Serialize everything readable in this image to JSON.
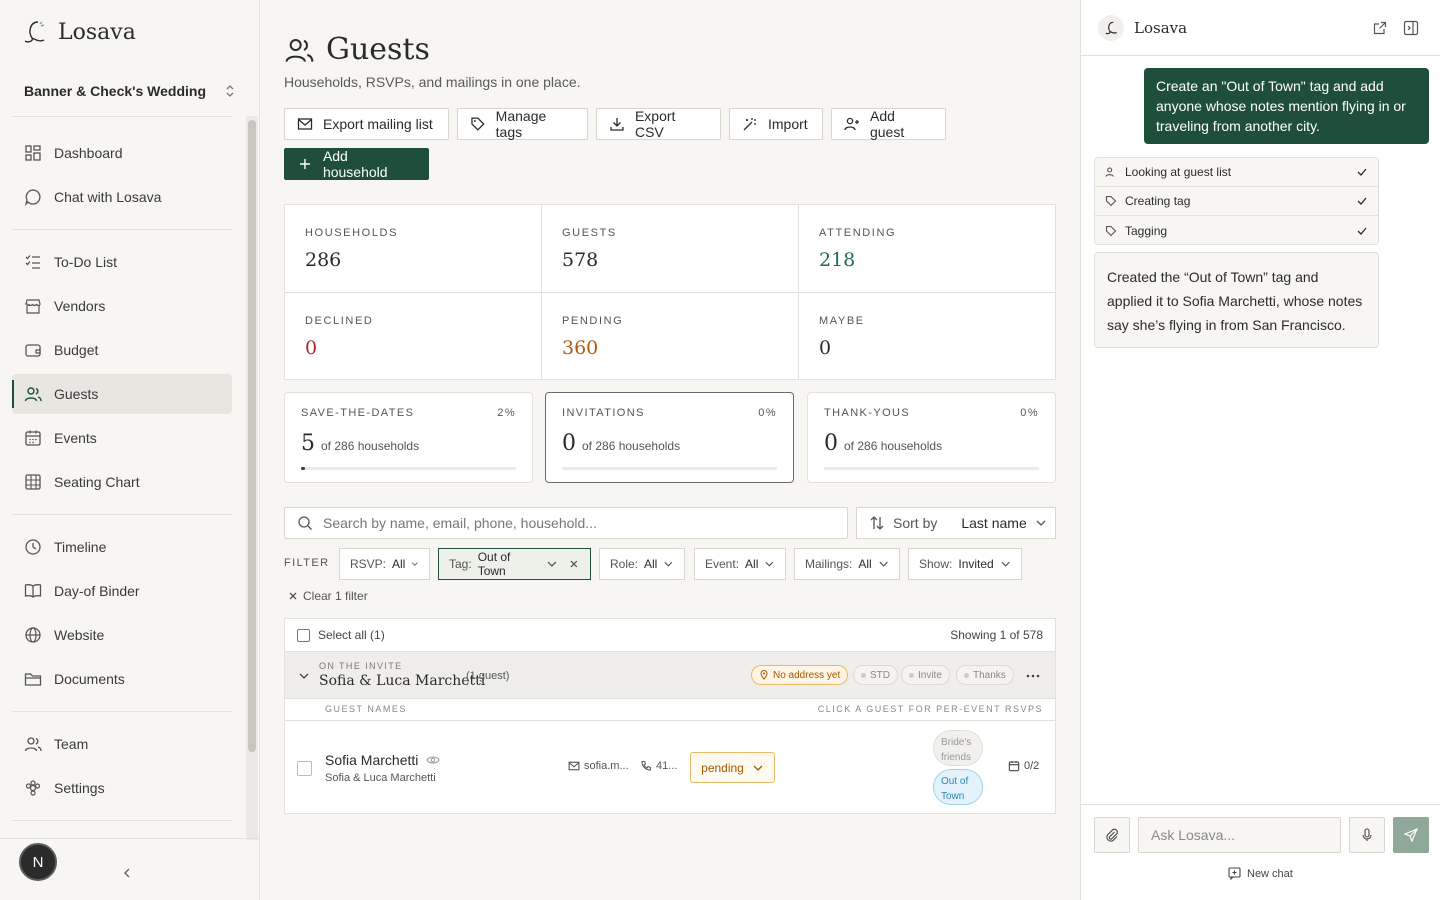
{
  "app": {
    "name": "Losava",
    "wedding": "Banner & Check's Wedding",
    "avatar_initial": "N"
  },
  "sidebar": {
    "items": [
      {
        "label": "Dashboard",
        "icon": "dashboard-icon"
      },
      {
        "label": "Chat with Losava",
        "icon": "chat-icon"
      },
      {
        "label": "To-Do List",
        "icon": "todo-icon"
      },
      {
        "label": "Vendors",
        "icon": "store-icon"
      },
      {
        "label": "Budget",
        "icon": "wallet-icon"
      },
      {
        "label": "Guests",
        "icon": "users-icon"
      },
      {
        "label": "Events",
        "icon": "calendar-icon"
      },
      {
        "label": "Seating Chart",
        "icon": "grid-icon"
      },
      {
        "label": "Timeline",
        "icon": "clock-icon"
      },
      {
        "label": "Day-of Binder",
        "icon": "book-icon"
      },
      {
        "label": "Website",
        "icon": "globe-icon"
      },
      {
        "label": "Documents",
        "icon": "folder-icon"
      },
      {
        "label": "Team",
        "icon": "team-icon"
      },
      {
        "label": "Settings",
        "icon": "settings-icon"
      }
    ]
  },
  "page": {
    "title": "Guests",
    "subtitle": "Households, RSVPs, and mailings in one place.",
    "buttons": {
      "export_mailing": "Export mailing list",
      "manage_tags": "Manage tags",
      "export_csv": "Export CSV",
      "import": "Import",
      "add_guest": "Add guest",
      "add_household": "Add household"
    }
  },
  "stats": {
    "households": {
      "label": "HOUSEHOLDS",
      "value": "286"
    },
    "guests": {
      "label": "GUESTS",
      "value": "578"
    },
    "attending": {
      "label": "ATTENDING",
      "value": "218",
      "color": "#1f6b4e"
    },
    "declined": {
      "label": "DECLINED",
      "value": "0",
      "color": "#b3262b"
    },
    "pending": {
      "label": "PENDING",
      "value": "360",
      "color": "#b35a10"
    },
    "maybe": {
      "label": "MAYBE",
      "value": "0"
    }
  },
  "mailings": [
    {
      "label": "SAVE-THE-DATES",
      "pct": "2%",
      "count": "5",
      "of": "of 286 households",
      "fraction": 0.02
    },
    {
      "label": "INVITATIONS",
      "pct": "0%",
      "count": "0",
      "of": "of 286 households",
      "fraction": 0
    },
    {
      "label": "THANK-YOUS",
      "pct": "0%",
      "count": "0",
      "of": "of 286 households",
      "fraction": 0
    }
  ],
  "search": {
    "placeholder": "Search by name, email, phone, household..."
  },
  "sort": {
    "label": "Sort by",
    "value": "Last name"
  },
  "filters": {
    "label": "FILTER",
    "rsvp": {
      "label": "RSVP:",
      "value": "All"
    },
    "tag": {
      "label": "Tag:",
      "value": "Out of Town"
    },
    "role": {
      "label": "Role:",
      "value": "All"
    },
    "event": {
      "label": "Event:",
      "value": "All"
    },
    "mailings": {
      "label": "Mailings:",
      "value": "All"
    },
    "show": {
      "label": "Show:",
      "value": "Invited"
    },
    "clear": "Clear 1 filter"
  },
  "table": {
    "select_all": "Select all (1)",
    "showing": "Showing 1 of 578",
    "household": {
      "on_invite": "ON THE INVITE",
      "name": "Sofia & Luca Marchetti",
      "count": "(1 guest)",
      "no_address": "No address yet",
      "tags": [
        "STD",
        "Invite",
        "Thanks"
      ]
    },
    "guest_names_label": "GUEST NAMES",
    "click_hint": "CLICK A GUEST FOR PER-EVENT RSVPS",
    "guest": {
      "name": "Sofia Marchetti",
      "household": "Sofia & Luca Marchetti",
      "email": "sofia.m...",
      "phone": "41...",
      "status": "pending",
      "tag_brides": "Bride's friends",
      "tag_out": "Out of Town",
      "events": "0/2"
    }
  },
  "chat": {
    "title": "Losava",
    "user_message": "Create an \"Out of Town\" tag and add anyone whose notes mention flying in or traveling from another city.",
    "steps": [
      "Looking at guest list",
      "Creating tag",
      "Tagging"
    ],
    "reply": "Created the “Out of Town” tag and applied it to Sofia Marchetti, whose notes say she’s flying in from San Francisco.",
    "input_placeholder": "Ask Losava...",
    "new_chat": "New chat"
  }
}
